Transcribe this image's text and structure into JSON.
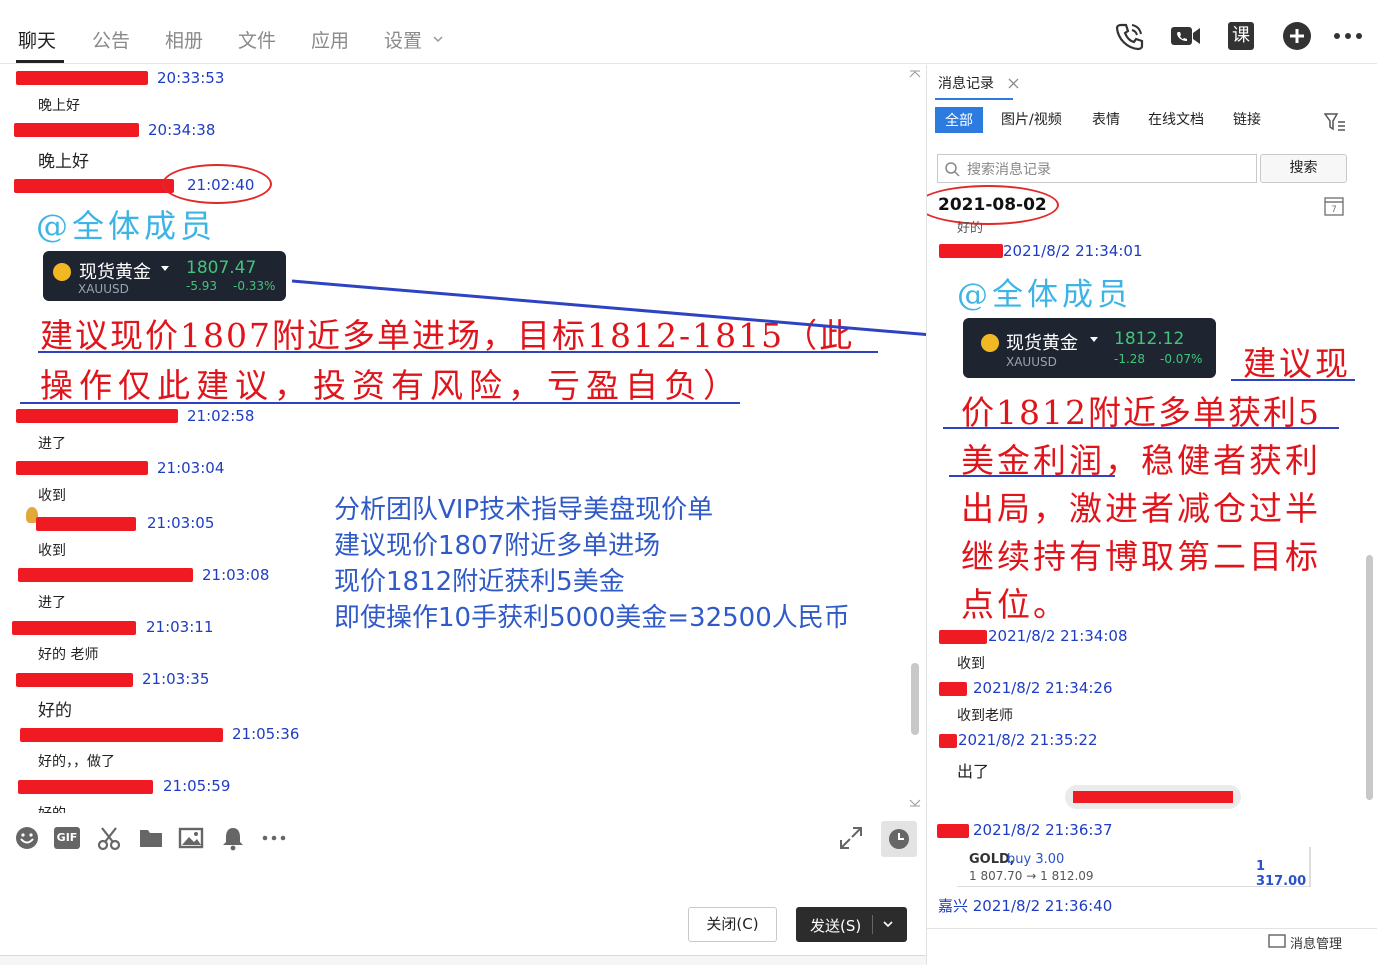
{
  "nav": {
    "tabs": [
      "聊天",
      "公告",
      "相册",
      "文件",
      "应用",
      "设置"
    ],
    "active_tab": "聊天",
    "settings_chevron": "chevron-down-icon"
  },
  "top_icons": [
    "phone-icon",
    "video-call-icon",
    "class-icon",
    "add-icon",
    "more-icon"
  ],
  "top_icons_text": {
    "class": "课"
  },
  "chat": {
    "messages": [
      {
        "time": "20:33:53",
        "text": "晚上好"
      },
      {
        "time": "20:34:38",
        "text": "晚上好"
      },
      {
        "time": "21:02:40",
        "text": "@全体成员"
      },
      {
        "time": "21:02:58",
        "text": "进了"
      },
      {
        "time": "21:03:04",
        "text": "收到"
      },
      {
        "time": "21:03:05",
        "text": "收到"
      },
      {
        "time": "21:03:08",
        "text": "进了"
      },
      {
        "time": "21:03:11",
        "text": "好的  老师"
      },
      {
        "time": "21:03:35",
        "text": "好的"
      },
      {
        "time": "21:05:36",
        "text": "好的，，做了"
      },
      {
        "time": "21:05:59",
        "text": "好的"
      }
    ],
    "gold_card": {
      "name": "现货黄金",
      "symbol": "XAUUSD",
      "price": "1807.47",
      "change": "-5.93",
      "change_pct": "-0.33%"
    },
    "red_annotation": {
      "line1": "建议现价1807附近多单进场，目标1812-1815（此",
      "line2": "操作仅此建议，投资有风险，亏盈自负）"
    },
    "blue_annotation": [
      "分析团队VIP技术指导美盘现价单",
      "建议现价1807附近多单进场",
      "现价1812附近获利5美金",
      "即使操作10手获利5000美金=32500人民币"
    ]
  },
  "toolbar": {
    "icons": [
      "emoji-icon",
      "gif-icon",
      "scissors-icon",
      "folder-icon",
      "image-icon",
      "bell-icon",
      "more-icon"
    ],
    "gif_label": "GIF",
    "right_icons": [
      "expand-icon",
      "history-icon"
    ],
    "close_label": "关闭(C)",
    "send_label": "发送(S)"
  },
  "panel": {
    "tab_title": "消息记录",
    "filters": [
      "全部",
      "图片/视频",
      "表情",
      "在线文档",
      "链接"
    ],
    "active_filter": "全部",
    "search": {
      "placeholder": "搜索消息记录",
      "button": "搜索"
    },
    "date": "2021-08-02",
    "records": [
      {
        "time": "",
        "text": "好的"
      },
      {
        "time": "2021/8/2 21:34:01",
        "text": "@全体成员"
      },
      {
        "time": "2021/8/2 21:34:08",
        "text": "收到"
      },
      {
        "time": "2021/8/2 21:34:26",
        "text": "收到老师"
      },
      {
        "time": "2021/8/2 21:35:22",
        "text": "出了"
      },
      {
        "time": "2021/8/2 21:36:37",
        "text": ""
      },
      {
        "time": "嘉兴 2021/8/2 21:36:40",
        "text": ""
      }
    ],
    "gold_card": {
      "name": "现货黄金",
      "symbol": "XAUUSD",
      "price": "1812.12",
      "change": "-1.28",
      "change_pct": "-0.07%"
    },
    "red_annotation": [
      "建议现",
      "价1812附近多单获利5",
      "美金利润，稳健者获利",
      "出局，激进者减仓过半",
      "继续持有博取第二目标",
      "点位。"
    ],
    "trade": {
      "symbol": "GOLD,",
      "side": "buy 3.00",
      "prices": "1 807.70 → 1 812.09",
      "profit": "1 317.00"
    },
    "footer_label": "消息管理"
  },
  "colors": {
    "accent_blue": "#2e7be0",
    "link_blue": "#1e3cc4",
    "annotation_red": "#e0141b",
    "annotation_blue": "#2f5ac8",
    "gold_green": "#41c57b",
    "card_bg": "#1e2430"
  }
}
